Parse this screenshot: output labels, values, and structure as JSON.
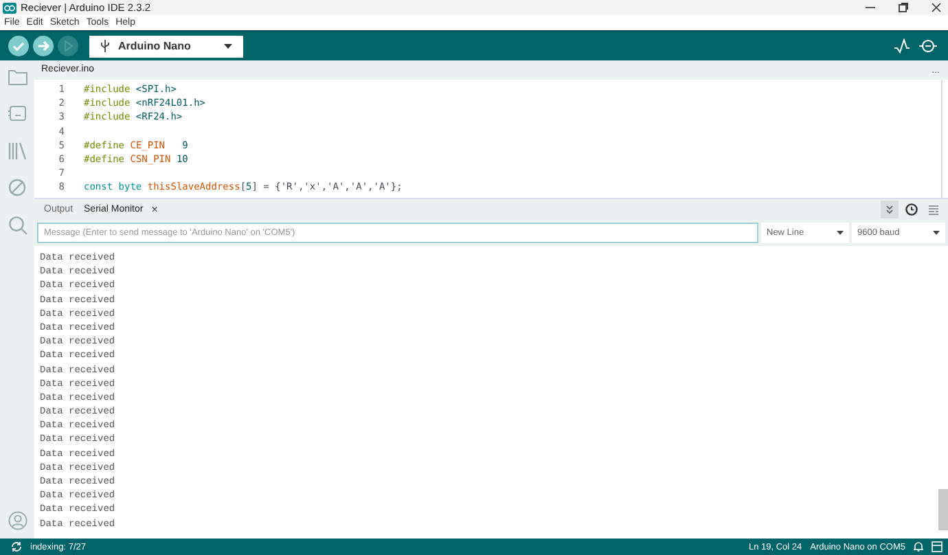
{
  "window": {
    "title": "Reciever | Arduino IDE 2.3.2"
  },
  "menu": [
    "File",
    "Edit",
    "Sketch",
    "Tools",
    "Help"
  ],
  "toolbar": {
    "board": "Arduino Nano",
    "debug_disabled": true
  },
  "editor_tabs": [
    {
      "label": "Reciever.ino",
      "selected": true
    }
  ],
  "editor_more": "...",
  "code": [
    {
      "number": "1",
      "tokens": [
        {
          "kind": "directive",
          "text": "#include"
        },
        {
          "kind": "header",
          "text": " <SPI.h>"
        }
      ]
    },
    {
      "number": "2",
      "tokens": [
        {
          "kind": "directive",
          "text": "#include"
        },
        {
          "kind": "header",
          "text": " <nRF24L01.h>"
        }
      ]
    },
    {
      "number": "3",
      "tokens": [
        {
          "kind": "directive",
          "text": "#include"
        },
        {
          "kind": "header",
          "text": " <RF24.h>"
        }
      ]
    },
    {
      "number": "4"
    },
    {
      "number": "5",
      "tokens": [
        {
          "kind": "directive",
          "text": "#define"
        },
        {
          "kind": "name",
          "text": " CE_PIN"
        },
        {
          "kind": "number",
          "text": "   9"
        }
      ]
    },
    {
      "number": "6",
      "tokens": [
        {
          "kind": "directive",
          "text": "#define"
        },
        {
          "kind": "name",
          "text": " CSN_PIN"
        },
        {
          "kind": "number",
          "text": " 10"
        }
      ]
    },
    {
      "number": "7"
    },
    {
      "number": "8",
      "tokens": [
        {
          "kind": "keyword",
          "text": "const"
        },
        {
          "kind": "keyword",
          "text": " byte"
        },
        {
          "kind": "name",
          "text": " thisSlaveAddress"
        },
        {
          "kind": "plain",
          "text": "["
        },
        {
          "kind": "number",
          "text": "5"
        },
        {
          "kind": "plain",
          "text": "] = {'R','x','A','A','A'};"
        }
      ]
    }
  ],
  "panel_tabs": [
    {
      "label": "Output",
      "selected": false
    },
    {
      "label": "Serial Monitor",
      "selected": true,
      "close": "×"
    }
  ],
  "panel_tools": {
    "autoscroll": true,
    "timestamp": false
  },
  "serial": {
    "message_placeholder": "Message (Enter to send message to 'Arduino Nano' on 'COM5')",
    "line_ending": "New Line",
    "baud": "9600 baud"
  },
  "output_lines": [
    "Data received",
    "Data received",
    "Data received",
    "Data received",
    "Data received",
    "Data received",
    "Data received",
    "Data received",
    "Data received",
    "Data received",
    "Data received",
    "Data received",
    "Data received",
    "Data received",
    "Data received",
    "Data received",
    "Data received",
    "Data received",
    "Data received",
    "Data received"
  ],
  "status_bar": {
    "indexing": "indexing: 7/27",
    "position": "Ln 19, Col 24",
    "board_port": "Arduino Nano on COM5"
  }
}
